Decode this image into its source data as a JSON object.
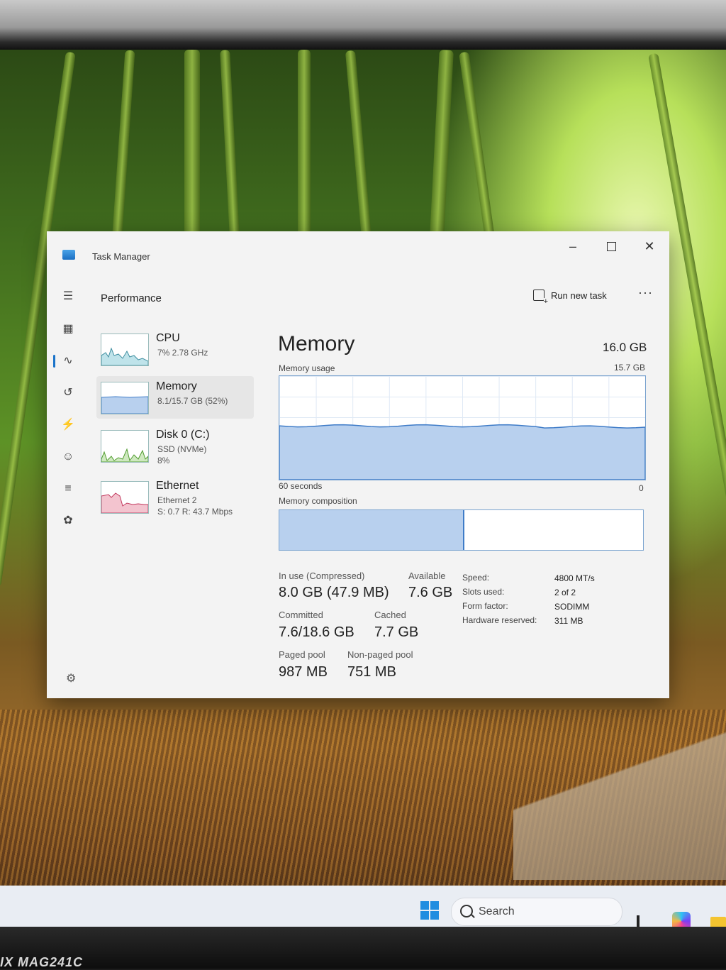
{
  "window": {
    "title": "Task Manager",
    "minimize_glyph": "–",
    "close_glyph": "✕"
  },
  "header": {
    "section": "Performance",
    "run_new_task": "Run new task",
    "more": "···"
  },
  "sidebar": {
    "items": [
      {
        "name": "CPU",
        "line1": "7% 2.78 GHz",
        "line2": "",
        "selected": false
      },
      {
        "name": "Memory",
        "line1": "8.1/15.7 GB (52%)",
        "line2": "",
        "selected": true
      },
      {
        "name": "Disk 0 (C:)",
        "line1": "SSD (NVMe)",
        "line2": "8%",
        "selected": false
      },
      {
        "name": "Ethernet",
        "line1": "Ethernet 2",
        "line2": "S: 0.7 R: 43.7 Mbps",
        "selected": false
      }
    ]
  },
  "memory": {
    "title": "Memory",
    "total": "16.0 GB",
    "usage_label": "Memory usage",
    "usage_max": "15.7 GB",
    "axis_left": "60 seconds",
    "axis_right": "0",
    "composition_label": "Memory composition",
    "in_use_fraction": 0.505,
    "usage_level_fraction": 0.52,
    "stats": {
      "in_use_label": "In use (Compressed)",
      "in_use_value": "8.0 GB (47.9 MB)",
      "available_label": "Available",
      "available_value": "7.6 GB",
      "committed_label": "Committed",
      "committed_value": "7.6/18.6 GB",
      "cached_label": "Cached",
      "cached_value": "7.7 GB",
      "paged_label": "Paged pool",
      "paged_value": "987 MB",
      "nonpaged_label": "Non-paged pool",
      "nonpaged_value": "751 MB"
    },
    "specs": [
      {
        "label": "Speed:",
        "value": "4800 MT/s"
      },
      {
        "label": "Slots used:",
        "value": "2 of 2"
      },
      {
        "label": "Form factor:",
        "value": "SODIMM"
      },
      {
        "label": "Hardware reserved:",
        "value": "311 MB"
      }
    ]
  },
  "taskbar": {
    "search_label": "Search"
  },
  "monitor": {
    "brand": "IX MAG241C"
  },
  "colors": {
    "memory_fill": "#b8d0ee",
    "memory_line": "#3f7cc8",
    "cpu_fill": "#bfe3ea",
    "disk_fill": "#cfe9c0",
    "ethernet_fill": "#f3c4cf",
    "accent": "#1a73c9"
  }
}
